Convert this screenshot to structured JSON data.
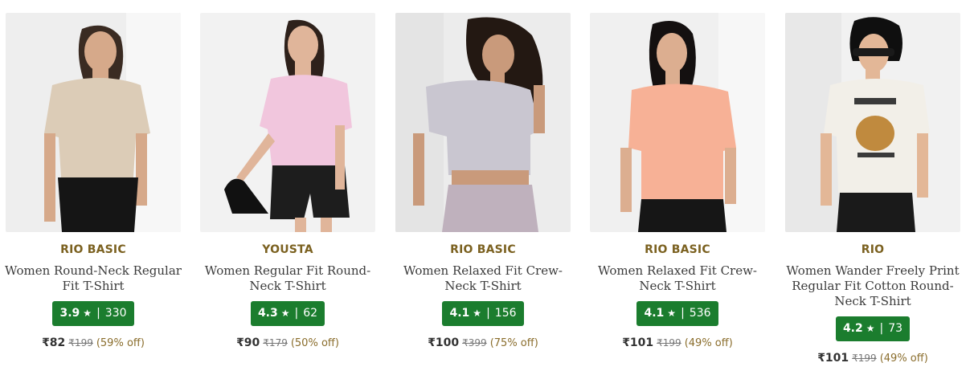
{
  "products": [
    {
      "brand": "RIO BASIC",
      "title": "Women Round-Neck Regular Fit T-Shirt",
      "rating": "3.9",
      "star": "★",
      "reviews": "330",
      "price": "₹82",
      "mrp": "₹199",
      "discount": "(59% off)",
      "shirt_color": "#dcccb7",
      "bottom_color": "#151515",
      "bg_color": "#eeeeee"
    },
    {
      "brand": "YOUSTA",
      "title": "Women Regular Fit Round-Neck T-Shirt",
      "rating": "4.3",
      "star": "★",
      "reviews": "62",
      "price": "₹90",
      "mrp": "₹179",
      "discount": "(50% off)",
      "shirt_color": "#f1c6dd",
      "bottom_color": "#1d1d1d",
      "bg_color": "#f2f2f2"
    },
    {
      "brand": "RIO BASIC",
      "title": "Women Relaxed Fit Crew-Neck T-Shirt",
      "rating": "4.1",
      "star": "★",
      "reviews": "156",
      "price": "₹100",
      "mrp": "₹399",
      "discount": "(75% off)",
      "shirt_color": "#c9c6d0",
      "bottom_color": "#bfb1bd",
      "bg_color": "#ececec"
    },
    {
      "brand": "RIO BASIC",
      "title": "Women Relaxed Fit Crew-Neck T-Shirt",
      "rating": "4.1",
      "star": "★",
      "reviews": "536",
      "price": "₹101",
      "mrp": "₹199",
      "discount": "(49% off)",
      "shirt_color": "#f7b196",
      "bottom_color": "#161616",
      "bg_color": "#f0f0f0"
    },
    {
      "brand": "RIO",
      "title": "Women Wander Freely Print Regular Fit Cotton Round-Neck T-Shirt",
      "rating": "4.2",
      "star": "★",
      "reviews": "73",
      "price": "₹101",
      "mrp": "₹199",
      "discount": "(49% off)",
      "shirt_color": "#f2efe8",
      "bottom_color": "#1a1a1a",
      "bg_color": "#f1f1f1"
    }
  ],
  "colors": {
    "brand_text": "#7b6120",
    "rating_bg": "#1b7d2e",
    "discount_text": "#8a6d2c"
  }
}
